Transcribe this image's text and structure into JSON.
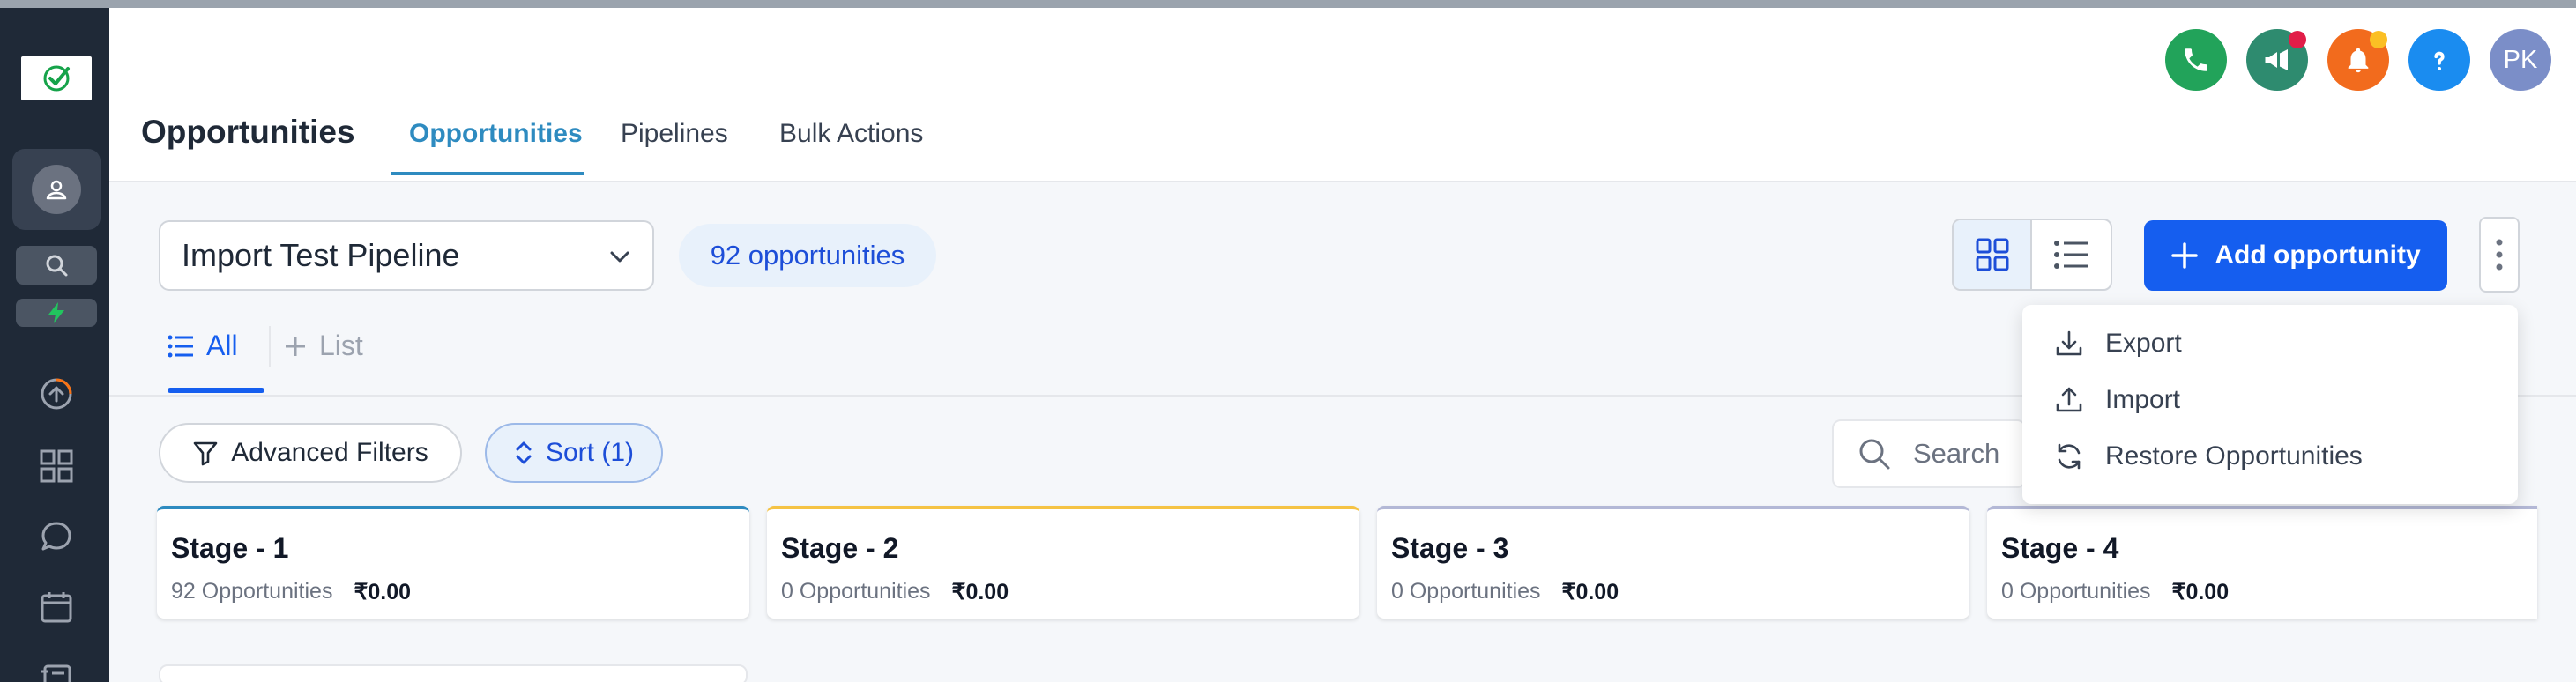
{
  "header": {
    "title": "Opportunities",
    "tabs": [
      {
        "label": "Opportunities",
        "active": true
      },
      {
        "label": "Pipelines",
        "active": false
      },
      {
        "label": "Bulk Actions",
        "active": false
      }
    ],
    "user_initials": "PK",
    "icons": [
      "phone-icon",
      "megaphone-icon",
      "bell-icon",
      "help-icon"
    ]
  },
  "toolbar": {
    "pipeline_selected": "Import Test Pipeline",
    "opportunity_count": "92 opportunities",
    "add_label": "Add opportunity"
  },
  "subtabs": {
    "all_label": "All",
    "list_label": "List"
  },
  "filters": {
    "advanced_label": "Advanced Filters",
    "sort_label": "Sort (1)",
    "search_placeholder": "Search O"
  },
  "menu": {
    "items": [
      "Export",
      "Import",
      "Restore Opportunities"
    ]
  },
  "stages": [
    {
      "name": "Stage - 1",
      "count": "92 Opportunities",
      "amount": "₹0.00",
      "color": "#2e8bc0"
    },
    {
      "name": "Stage - 2",
      "count": "0 Opportunities",
      "amount": "₹0.00",
      "color": "#f5c344"
    },
    {
      "name": "Stage - 3",
      "count": "0 Opportunities",
      "amount": "₹0.00",
      "color": "#b3b8d6"
    },
    {
      "name": "Stage - 4",
      "count": "0 Opportunities",
      "amount": "₹0.00",
      "color": "#b3b8d6"
    }
  ],
  "colors": {
    "primary": "#155eef",
    "tab_active": "#2e8bc0",
    "sidebar": "#1f2937",
    "phone_button": "#22a35a",
    "megaphone_button": "#2e8b6f",
    "bell_button": "#f26b1d",
    "help_button": "#1a8cf0",
    "avatar": "#7b8ec8"
  }
}
